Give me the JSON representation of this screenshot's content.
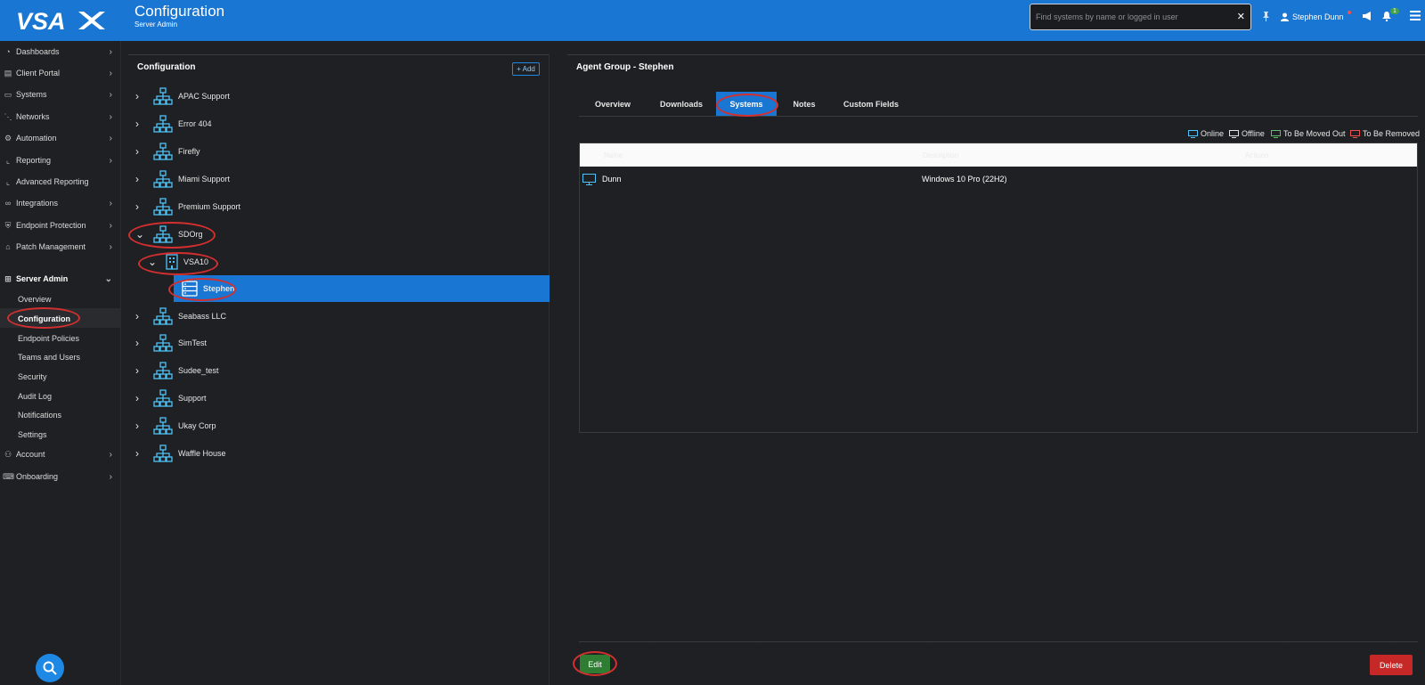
{
  "header": {
    "logo_text": "VSAX",
    "title": "Configuration",
    "subtitle": "Server Admin",
    "search_placeholder": "Find systems by name or logged in user",
    "user_name": "Stephen Dunn",
    "notification_count": "1"
  },
  "sidebar": {
    "items": [
      {
        "label": "Dashboards",
        "icon": "dashboard-icon"
      },
      {
        "label": "Client Portal",
        "icon": "portal-icon"
      },
      {
        "label": "Systems",
        "icon": "monitor-icon"
      },
      {
        "label": "Networks",
        "icon": "network-icon"
      },
      {
        "label": "Automation",
        "icon": "gears-icon"
      },
      {
        "label": "Reporting",
        "icon": "chart-icon"
      },
      {
        "label": "Advanced Reporting",
        "icon": "chart-line-icon"
      },
      {
        "label": "Integrations",
        "icon": "infinity-icon"
      },
      {
        "label": "Endpoint Protection",
        "icon": "shield-icon"
      },
      {
        "label": "Patch Management",
        "icon": "home-icon"
      }
    ],
    "server_admin": {
      "label": "Server Admin",
      "subitems": [
        "Overview",
        "Configuration",
        "Endpoint Policies",
        "Teams and Users",
        "Security",
        "Audit Log",
        "Notifications",
        "Settings"
      ]
    },
    "bottom_items": [
      {
        "label": "Account",
        "icon": "user-icon"
      },
      {
        "label": "Onboarding",
        "icon": "graduation-icon"
      }
    ]
  },
  "tree": {
    "title": "Configuration",
    "add_label": "+ Add",
    "nodes": [
      "APAC Support",
      "Error 404",
      "Firefly",
      "Miami Support",
      "Premium Support",
      "SDOrg",
      "VSA10",
      "Stephen",
      "Seabass LLC",
      "SimTest",
      "Sudee_test",
      "Support",
      "Ukay Corp",
      "Waffle House"
    ]
  },
  "detail": {
    "title": "Agent Group - Stephen",
    "tabs": [
      "Overview",
      "Downloads",
      "Systems",
      "Notes",
      "Custom Fields"
    ],
    "active_tab": "Systems",
    "legend": [
      "Online",
      "Offline",
      "To Be Moved Out",
      "To Be Removed"
    ],
    "columns": [
      "Name",
      "Description",
      "Actions"
    ],
    "rows": [
      {
        "name": "Dunn",
        "description": "Windows 10 Pro (22H2)"
      }
    ],
    "edit_label": "Edit",
    "delete_label": "Delete"
  },
  "colors": {
    "accent": "#1976d2",
    "edit": "#2e7d32",
    "delete": "#c62828",
    "annotation": "#d32f2f"
  }
}
